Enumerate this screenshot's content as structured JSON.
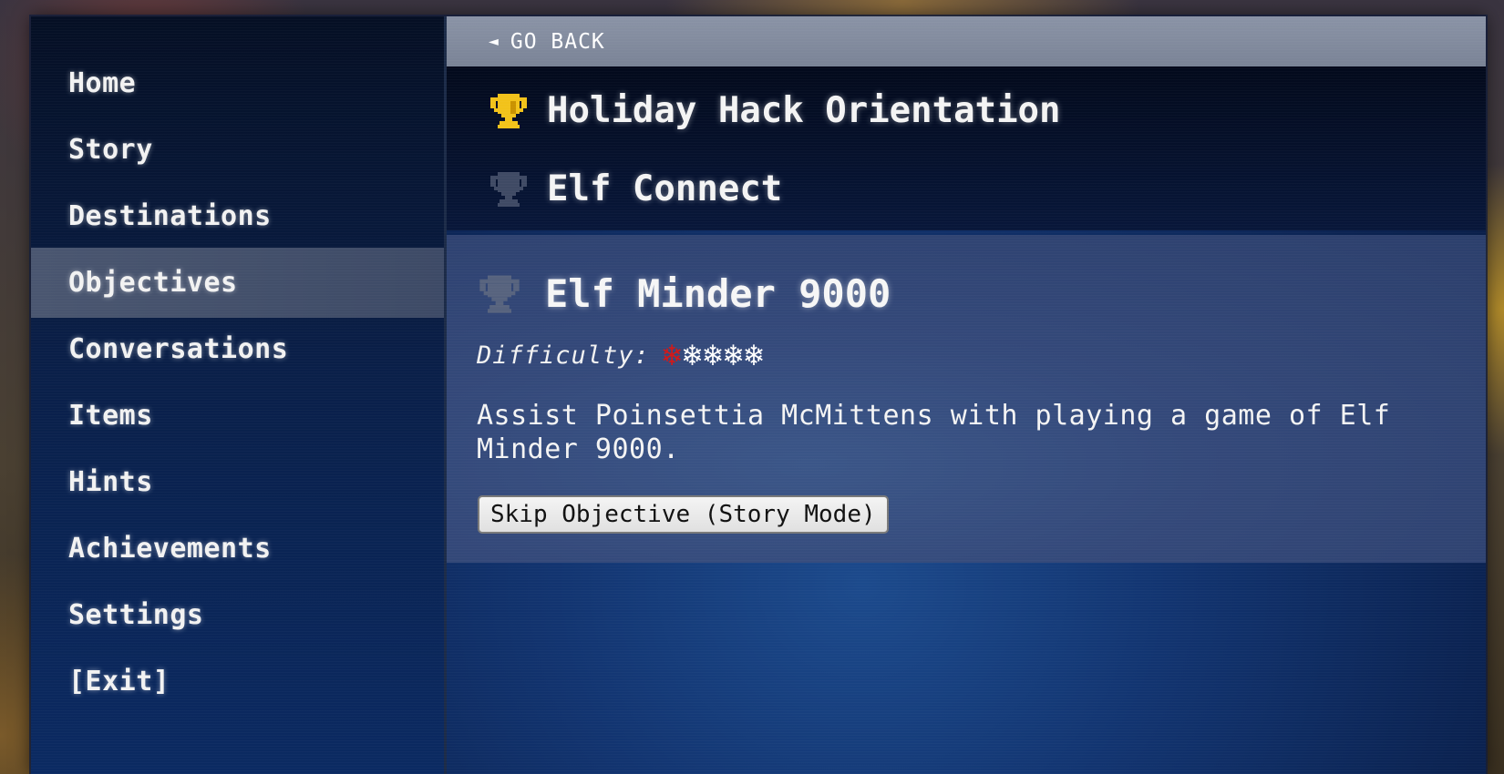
{
  "sidebar": {
    "items": [
      {
        "label": "Home"
      },
      {
        "label": "Story"
      },
      {
        "label": "Destinations"
      },
      {
        "label": "Objectives",
        "active": true
      },
      {
        "label": "Conversations"
      },
      {
        "label": "Items"
      },
      {
        "label": "Hints"
      },
      {
        "label": "Achievements"
      },
      {
        "label": "Settings"
      },
      {
        "label": "[Exit]"
      }
    ]
  },
  "main": {
    "go_back": {
      "arrow": "◄",
      "label": "GO BACK"
    },
    "objectives": [
      {
        "title": "Holiday Hack Orientation",
        "completed": true,
        "icon": "trophy-icon"
      },
      {
        "title": "Elf Connect",
        "completed": false,
        "icon": "trophy-icon"
      }
    ],
    "selected": {
      "title": "Elf Minder 9000",
      "completed": false,
      "icon": "trophy-icon",
      "difficulty_label": "Difficulty:",
      "difficulty": {
        "level": 1,
        "max": 5,
        "glyph": "❄",
        "active_color": "#d01818",
        "inactive_color": "#ffffff"
      },
      "description": "Assist Poinsettia McMittens with playing a game of Elf Minder 9000.",
      "skip_button": "Skip Objective (Story Mode)"
    }
  },
  "colors": {
    "trophy_gold": "#f2c21a",
    "trophy_inactive": "#4b5670",
    "active_nav_bg": "#4a5670"
  }
}
